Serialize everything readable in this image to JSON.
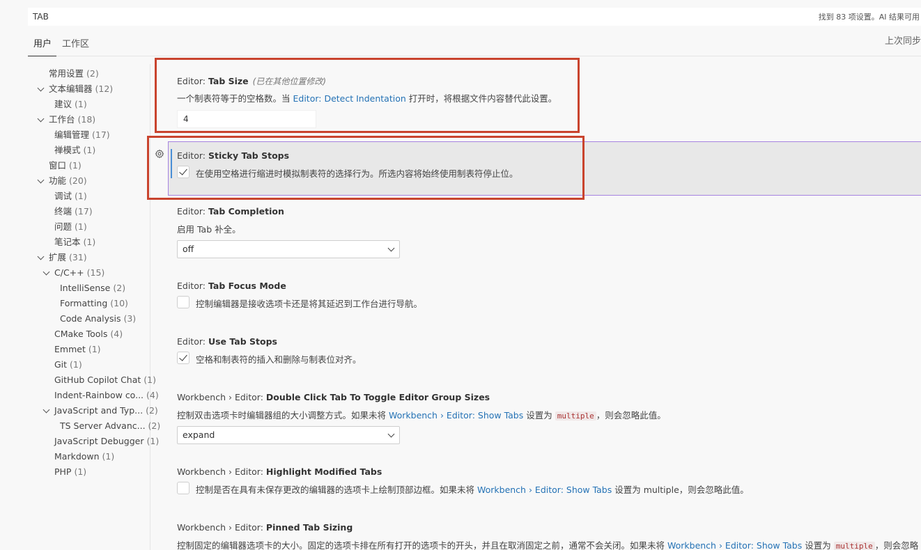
{
  "search": {
    "query": "TAB",
    "result_text": "找到 83 项设置。AI 结果可用"
  },
  "tabs": [
    {
      "label": "用户",
      "active": true
    },
    {
      "label": "工作区",
      "active": false
    }
  ],
  "last_sync": "上次同步",
  "toc": [
    {
      "label": "常用设置",
      "count": "(2)"
    },
    {
      "label": "文本编辑器",
      "count": "(12)"
    },
    {
      "label": "建议",
      "count": "(1)"
    },
    {
      "label": "工作台",
      "count": "(18)"
    },
    {
      "label": "编辑管理",
      "count": "(17)"
    },
    {
      "label": "禅模式",
      "count": "(1)"
    },
    {
      "label": "窗口",
      "count": "(1)"
    },
    {
      "label": "功能",
      "count": "(20)"
    },
    {
      "label": "调试",
      "count": "(1)"
    },
    {
      "label": "终端",
      "count": "(17)"
    },
    {
      "label": "问题",
      "count": "(1)"
    },
    {
      "label": "笔记本",
      "count": "(1)"
    },
    {
      "label": "扩展",
      "count": "(31)"
    },
    {
      "label": "C/C++",
      "count": "(15)"
    },
    {
      "label": "IntelliSense",
      "count": "(2)"
    },
    {
      "label": "Formatting",
      "count": "(10)"
    },
    {
      "label": "Code Analysis",
      "count": "(3)"
    },
    {
      "label": "CMake Tools",
      "count": "(4)"
    },
    {
      "label": "Emmet",
      "count": "(1)"
    },
    {
      "label": "Git",
      "count": "(1)"
    },
    {
      "label": "GitHub Copilot Chat",
      "count": "(1)"
    },
    {
      "label": "Indent-Rainbow co...",
      "count": "(4)"
    },
    {
      "label": "JavaScript and Typ...",
      "count": "(2)"
    },
    {
      "label": "TS Server Advanc...",
      "count": "(2)"
    },
    {
      "label": "JavaScript Debugger",
      "count": "(1)"
    },
    {
      "label": "Markdown",
      "count": "(1)"
    },
    {
      "label": "PHP",
      "count": "(1)"
    }
  ],
  "settings": {
    "tab_size": {
      "category": "Editor: ",
      "name": "Tab Size",
      "modified_note": "(已在其他位置修改)",
      "desc_pre": "一个制表符等于的空格数。当 ",
      "desc_link": "Editor: Detect Indentation",
      "desc_post": " 打开时，将根据文件内容替代此设置。",
      "value": "4"
    },
    "sticky_tab_stops": {
      "category": "Editor: ",
      "name": "Sticky Tab Stops",
      "checkbox_label": "在使用空格进行缩进时模拟制表符的选择行为。所选内容将始终使用制表符停止位。",
      "checked": true
    },
    "tab_completion": {
      "category": "Editor: ",
      "name": "Tab Completion",
      "desc": "启用 Tab 补全。",
      "value": "off"
    },
    "tab_focus_mode": {
      "category": "Editor: ",
      "name": "Tab Focus Mode",
      "checkbox_label": "控制编辑器是接收选项卡还是将其延迟到工作台进行导航。",
      "checked": false
    },
    "use_tab_stops": {
      "category": "Editor: ",
      "name": "Use Tab Stops",
      "checkbox_label": "空格和制表符的插入和删除与制表位对齐。",
      "checked": true
    },
    "double_click_tab": {
      "category": "Workbench › Editor: ",
      "name": "Double Click Tab To Toggle Editor Group Sizes",
      "desc_pre": "控制双击选项卡时编辑器组的大小调整方式。如果未将 ",
      "desc_link": "Workbench › Editor: Show Tabs",
      "desc_mid": " 设置为 ",
      "desc_code": "multiple",
      "desc_post": "，则会忽略此值。",
      "value": "expand"
    },
    "highlight_modified_tabs": {
      "category": "Workbench › Editor: ",
      "name": "Highlight Modified Tabs",
      "checkbox_pre": "控制是否在具有未保存更改的编辑器的选项卡上绘制顶部边框。如果未将 ",
      "checkbox_link": "Workbench › Editor: Show Tabs",
      "checkbox_post": " 设置为 multiple，则会忽略此值。",
      "checked": false
    },
    "pinned_tab_sizing": {
      "category": "Workbench › Editor: ",
      "name": "Pinned Tab Sizing",
      "desc_pre": "控制固定的编辑器选项卡的大小。固定的选项卡排在所有打开的选项卡的开头，并且在取消固定之前，通常不会关闭。如果未将 ",
      "desc_link": "Workbench › Editor: Show Tabs",
      "desc_mid": " 设置为 ",
      "desc_code": "multiple",
      "desc_post": "，则会忽略"
    }
  }
}
